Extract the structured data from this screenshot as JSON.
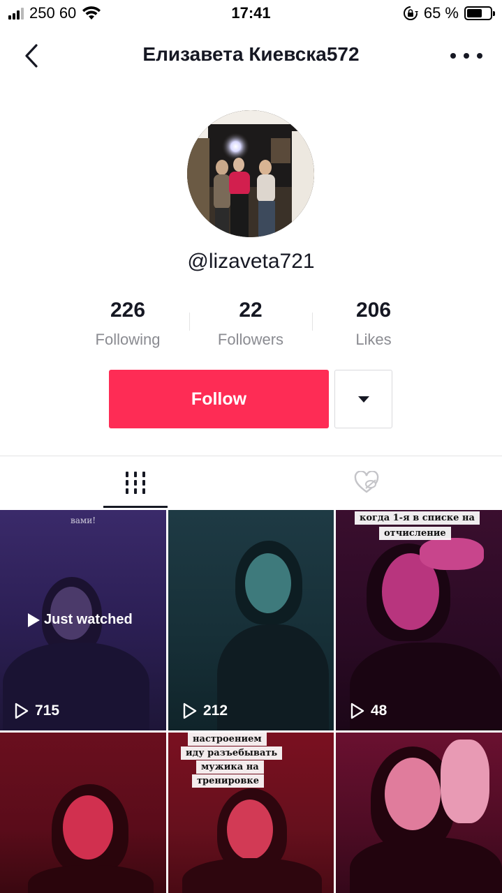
{
  "status_bar": {
    "carrier": "250 60",
    "time": "17:41",
    "battery_percent": "65 %",
    "battery_level": 0.65,
    "icons": [
      "signal-icon",
      "wifi-icon",
      "orientation-lock-icon",
      "battery-icon"
    ]
  },
  "header": {
    "title": "Елизавета Киевска572",
    "back_icon": "chevron-left-icon",
    "more_icon": "more-horizontal-icon"
  },
  "profile": {
    "username": "@lizaveta721"
  },
  "stats": [
    {
      "value": "226",
      "label": "Following"
    },
    {
      "value": "22",
      "label": "Followers"
    },
    {
      "value": "206",
      "label": "Likes"
    }
  ],
  "actions": {
    "follow_label": "Follow",
    "dropdown_icon": "caret-down-icon"
  },
  "tabs": [
    {
      "name": "videos",
      "icon": "grid-icon",
      "active": true
    },
    {
      "name": "liked",
      "icon": "heart-hidden-icon",
      "active": false
    }
  ],
  "videos": [
    {
      "views": "715",
      "overlay": "Just watched",
      "caption": "вами!"
    },
    {
      "views": "212",
      "overlay": "",
      "caption": ""
    },
    {
      "views": "48",
      "overlay": "",
      "caption_lines": [
        "когда 1-я в списке на",
        "отчисление"
      ]
    },
    {
      "views": "",
      "overlay": "",
      "caption": ""
    },
    {
      "views": "",
      "overlay": "",
      "caption_lines": [
        "настроением",
        "иду разъебывать",
        "мужика на",
        "тренировке"
      ]
    },
    {
      "views": "",
      "overlay": "",
      "caption": ""
    }
  ],
  "colors": {
    "accent": "#fe2c55",
    "text_primary": "#161823",
    "text_secondary": "#8a8b91"
  }
}
